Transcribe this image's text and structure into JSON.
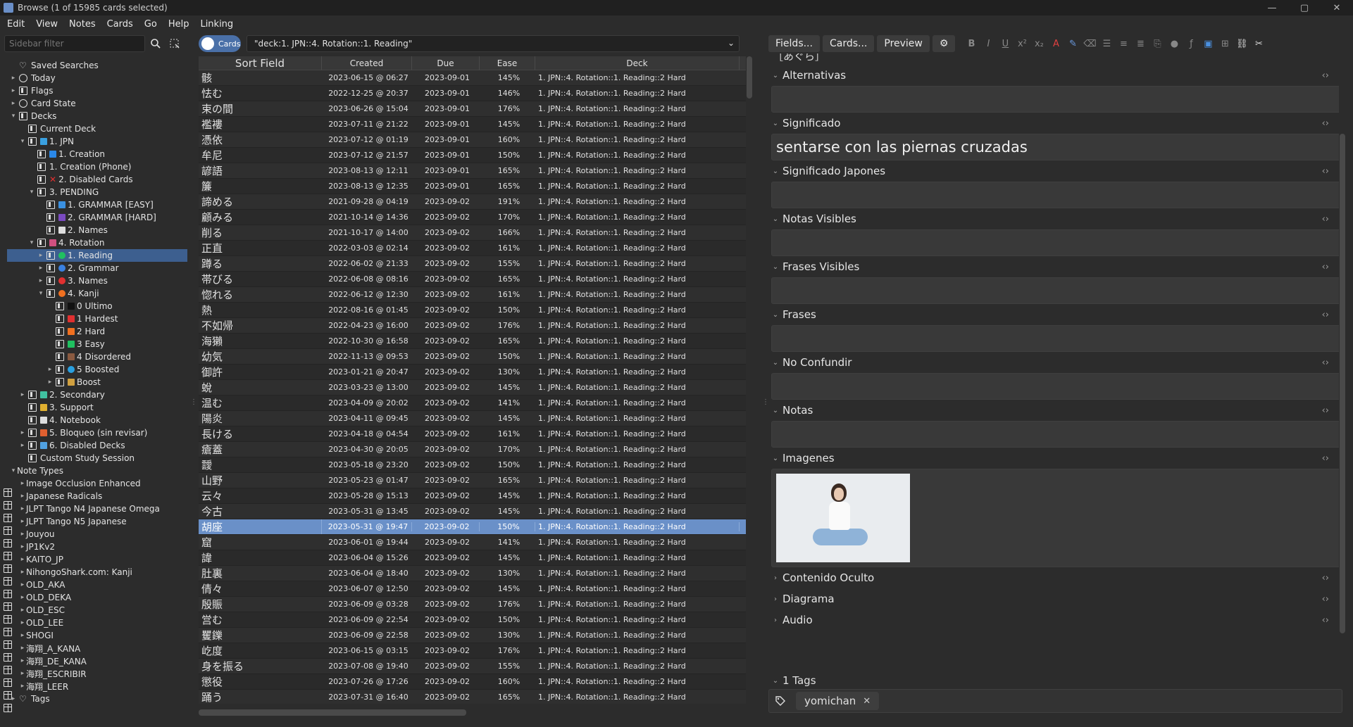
{
  "window": {
    "title": "Browse (1 of 15985 cards selected)",
    "minimize": "—",
    "maximize": "▢",
    "close": "✕"
  },
  "menu": [
    "Edit",
    "View",
    "Notes",
    "Cards",
    "Go",
    "Help",
    "Linking"
  ],
  "sidebar": {
    "filter_placeholder": "Sidebar filter",
    "tree": [
      {
        "d": 0,
        "a": "",
        "ic": "heart",
        "t": "Saved Searches"
      },
      {
        "d": 0,
        "a": "▸",
        "ic": "circle",
        "t": "Today"
      },
      {
        "d": 0,
        "a": "▸",
        "ic": "deck",
        "t": "Flags"
      },
      {
        "d": 0,
        "a": "▸",
        "ic": "circle",
        "t": "Card State"
      },
      {
        "d": 0,
        "a": "▾",
        "ic": "deck",
        "t": "Decks"
      },
      {
        "d": 1,
        "a": "",
        "ic": "deck",
        "t": "Current Deck"
      },
      {
        "d": 1,
        "a": "▾",
        "ic": "deck",
        "t": "1. JPN",
        "sw": "#3aa0e0"
      },
      {
        "d": 2,
        "a": "",
        "ic": "deck",
        "t": "1. Creation",
        "sw": "#2a88e8"
      },
      {
        "d": 2,
        "a": "",
        "ic": "deck",
        "t": "1. Creation (Phone)"
      },
      {
        "d": 2,
        "a": "",
        "ic": "deck",
        "t": "2. Disabled Cards",
        "x": "#e03030"
      },
      {
        "d": 2,
        "a": "▾",
        "ic": "deck",
        "t": "3. PENDING"
      },
      {
        "d": 3,
        "a": "",
        "ic": "deck",
        "t": "1. GRAMMAR [EASY]",
        "sw": "#3a90e0"
      },
      {
        "d": 3,
        "a": "",
        "ic": "deck",
        "t": "2. GRAMMAR [HARD]",
        "sw": "#7a4ac0"
      },
      {
        "d": 3,
        "a": "",
        "ic": "deck",
        "t": "2. Names",
        "sw": "#dddddd"
      },
      {
        "d": 2,
        "a": "▾",
        "ic": "deck",
        "t": "4. Rotation",
        "sw": "#d05080"
      },
      {
        "d": 3,
        "a": "▸",
        "ic": "deck",
        "t": "1. Reading",
        "dot": "#20c060",
        "sel": true
      },
      {
        "d": 3,
        "a": "▸",
        "ic": "deck",
        "t": "2. Grammar",
        "dot": "#3a80e0"
      },
      {
        "d": 3,
        "a": "▸",
        "ic": "deck",
        "t": "3. Names",
        "dot": "#e03030"
      },
      {
        "d": 3,
        "a": "▾",
        "ic": "deck",
        "t": "4. Kanji",
        "dot": "#f07020"
      },
      {
        "d": 4,
        "a": "",
        "ic": "deck",
        "t": "0 Ultimo",
        "sw": "#111111"
      },
      {
        "d": 4,
        "a": "",
        "ic": "deck",
        "t": "1 Hardest",
        "sw": "#e03030"
      },
      {
        "d": 4,
        "a": "",
        "ic": "deck",
        "t": "2 Hard",
        "sw": "#f07020"
      },
      {
        "d": 4,
        "a": "",
        "ic": "deck",
        "t": "3 Easy",
        "sw": "#20c060"
      },
      {
        "d": 4,
        "a": "",
        "ic": "deck",
        "t": "4 Disordered",
        "sw": "#8a5a40"
      },
      {
        "d": 4,
        "a": "▸",
        "ic": "deck",
        "t": "5 Boosted",
        "dot": "#2aa0e0"
      },
      {
        "d": 4,
        "a": "▸",
        "ic": "deck",
        "t": "Boost",
        "sw": "#d0a040"
      },
      {
        "d": 1,
        "a": "▸",
        "ic": "deck",
        "t": "2. Secondary",
        "sw": "#40c0a0"
      },
      {
        "d": 1,
        "a": "",
        "ic": "deck",
        "t": "3. Support",
        "sw": "#e0b030"
      },
      {
        "d": 1,
        "a": "",
        "ic": "deck",
        "t": "4. Notebook",
        "sw": "#dddddd"
      },
      {
        "d": 1,
        "a": "▸",
        "ic": "deck",
        "t": "5. Bloqueo (sin revisar)",
        "sw": "#e06030"
      },
      {
        "d": 1,
        "a": "▸",
        "ic": "deck",
        "t": "6. Disabled Decks",
        "sw": "#50a0e0"
      },
      {
        "d": 1,
        "a": "",
        "ic": "deck",
        "t": "Custom Study Session"
      },
      {
        "d": 0,
        "a": "▾",
        "ic": "table",
        "t": "Note Types"
      },
      {
        "d": 1,
        "a": "▸",
        "ic": "table",
        "t": "Image Occlusion Enhanced"
      },
      {
        "d": 1,
        "a": "▸",
        "ic": "table",
        "t": "Japanese Radicals"
      },
      {
        "d": 1,
        "a": "▸",
        "ic": "table",
        "t": "JLPT Tango N4 Japanese Omega"
      },
      {
        "d": 1,
        "a": "▸",
        "ic": "table",
        "t": "JLPT Tango N5 Japanese"
      },
      {
        "d": 1,
        "a": "▸",
        "ic": "table",
        "t": "Jouyou"
      },
      {
        "d": 1,
        "a": "▸",
        "ic": "table",
        "t": "JP1Kv2"
      },
      {
        "d": 1,
        "a": "▸",
        "ic": "table",
        "t": "KAITO_JP"
      },
      {
        "d": 1,
        "a": "▸",
        "ic": "table",
        "t": "NihongoShark.com: Kanji"
      },
      {
        "d": 1,
        "a": "▸",
        "ic": "table",
        "t": "OLD_AKA"
      },
      {
        "d": 1,
        "a": "▸",
        "ic": "table",
        "t": "OLD_DEKA"
      },
      {
        "d": 1,
        "a": "▸",
        "ic": "table",
        "t": "OLD_ESC"
      },
      {
        "d": 1,
        "a": "▸",
        "ic": "table",
        "t": "OLD_LEE"
      },
      {
        "d": 1,
        "a": "▸",
        "ic": "table",
        "t": "SHOGI"
      },
      {
        "d": 1,
        "a": "▸",
        "ic": "table",
        "t": "海翔_A_KANA"
      },
      {
        "d": 1,
        "a": "▸",
        "ic": "table",
        "t": "海翔_DE_KANA"
      },
      {
        "d": 1,
        "a": "▸",
        "ic": "table",
        "t": "海翔_ESCRIBIR"
      },
      {
        "d": 1,
        "a": "▸",
        "ic": "table",
        "t": "海翔_LEER"
      },
      {
        "d": 0,
        "a": "▸",
        "ic": "heart",
        "t": "Tags"
      }
    ]
  },
  "browser": {
    "toggle_label": "Cards",
    "search_query": "\"deck:1. JPN::4. Rotation::1. Reading\"",
    "columns": [
      "Sort Field",
      "Created",
      "Due",
      "Ease",
      "Deck"
    ],
    "deck_text": "1. JPN::4. Rotation::1. Reading::2 Hard",
    "rows": [
      [
        "骸",
        "2023-06-15 @ 06:27",
        "2023-09-01",
        "145%"
      ],
      [
        "怯む",
        "2022-12-25 @ 20:37",
        "2023-09-01",
        "146%"
      ],
      [
        "束の間",
        "2023-06-26 @ 15:04",
        "2023-09-01",
        "176%"
      ],
      [
        "襤褸",
        "2023-07-11 @ 21:22",
        "2023-09-01",
        "145%"
      ],
      [
        "憑依",
        "2023-07-12 @ 01:19",
        "2023-09-01",
        "160%"
      ],
      [
        "牟尼",
        "2023-07-12 @ 21:57",
        "2023-09-01",
        "150%"
      ],
      [
        "諺語",
        "2023-08-13 @ 12:11",
        "2023-09-01",
        "165%"
      ],
      [
        "簾",
        "2023-08-13 @ 12:35",
        "2023-09-01",
        "165%"
      ],
      [
        "諦める",
        "2021-09-28 @ 04:19",
        "2023-09-02",
        "191%"
      ],
      [
        "顧みる",
        "2021-10-14 @ 14:36",
        "2023-09-02",
        "170%"
      ],
      [
        "削る",
        "2021-10-17 @ 14:00",
        "2023-09-02",
        "166%"
      ],
      [
        "正直",
        "2022-03-03 @ 02:14",
        "2023-09-02",
        "161%"
      ],
      [
        "蹲る",
        "2022-06-02 @ 21:33",
        "2023-09-02",
        "155%"
      ],
      [
        "帯びる",
        "2022-06-08 @ 08:16",
        "2023-09-02",
        "165%"
      ],
      [
        "惚れる",
        "2022-06-12 @ 12:30",
        "2023-09-02",
        "161%"
      ],
      [
        "熱",
        "2022-08-16 @ 01:45",
        "2023-09-02",
        "150%"
      ],
      [
        "不如帰",
        "2022-04-23 @ 16:00",
        "2023-09-02",
        "176%"
      ],
      [
        "海獺",
        "2022-10-30 @ 16:58",
        "2023-09-02",
        "165%"
      ],
      [
        "幼気",
        "2022-11-13 @ 09:53",
        "2023-09-02",
        "150%"
      ],
      [
        "御許",
        "2023-01-21 @ 20:47",
        "2023-09-02",
        "130%"
      ],
      [
        "蛻",
        "2023-03-23 @ 13:00",
        "2023-09-02",
        "145%"
      ],
      [
        "温む",
        "2023-04-09 @ 20:02",
        "2023-09-02",
        "141%"
      ],
      [
        "陽炎",
        "2023-04-11 @ 09:45",
        "2023-09-02",
        "145%"
      ],
      [
        "長ける",
        "2023-04-18 @ 04:54",
        "2023-09-02",
        "161%"
      ],
      [
        "瘡蓋",
        "2023-04-30 @ 20:05",
        "2023-09-02",
        "170%"
      ],
      [
        "靉",
        "2023-05-18 @ 23:20",
        "2023-09-02",
        "150%"
      ],
      [
        "山野",
        "2023-05-23 @ 01:47",
        "2023-09-02",
        "165%"
      ],
      [
        "云々",
        "2023-05-28 @ 15:13",
        "2023-09-02",
        "145%"
      ],
      [
        "今古",
        "2023-05-31 @ 13:45",
        "2023-09-02",
        "145%"
      ],
      [
        "胡座",
        "2023-05-31 @ 19:47",
        "2023-09-02",
        "150%"
      ],
      [
        "窟",
        "2023-06-01 @ 19:44",
        "2023-09-02",
        "141%"
      ],
      [
        "諱",
        "2023-06-04 @ 15:26",
        "2023-09-02",
        "145%"
      ],
      [
        "肚裏",
        "2023-06-04 @ 18:40",
        "2023-09-02",
        "130%"
      ],
      [
        "倩々",
        "2023-06-07 @ 12:50",
        "2023-09-02",
        "145%"
      ],
      [
        "殷賑",
        "2023-06-09 @ 03:28",
        "2023-09-02",
        "176%"
      ],
      [
        "営む",
        "2023-06-09 @ 22:54",
        "2023-09-02",
        "150%"
      ],
      [
        "矍鑠",
        "2023-06-09 @ 22:58",
        "2023-09-02",
        "130%"
      ],
      [
        "屹度",
        "2023-06-15 @ 03:15",
        "2023-09-02",
        "176%"
      ],
      [
        "身を振る",
        "2023-07-08 @ 19:40",
        "2023-09-02",
        "155%"
      ],
      [
        "懲役",
        "2023-07-26 @ 17:26",
        "2023-09-02",
        "160%"
      ],
      [
        "踊う",
        "2023-07-31 @ 16:40",
        "2023-09-02",
        "165%"
      ]
    ],
    "selected_index": 29
  },
  "editor": {
    "buttons": {
      "fields": "Fields...",
      "cards": "Cards...",
      "preview": "Preview"
    },
    "partial_top": "［あぐら］",
    "fields": [
      {
        "name": "Alternativas",
        "value": "",
        "open": true
      },
      {
        "name": "Significado",
        "value": "sentarse con las piernas cruzadas",
        "open": true
      },
      {
        "name": "Significado Japones",
        "value": "",
        "open": true
      },
      {
        "name": "Notas Visibles",
        "value": "",
        "open": true
      },
      {
        "name": "Frases Visibles",
        "value": "",
        "open": true
      },
      {
        "name": "Frases",
        "value": "",
        "open": true
      },
      {
        "name": "No Confundir",
        "value": "",
        "open": true
      },
      {
        "name": "Notas",
        "value": "",
        "open": true
      },
      {
        "name": "Imagenes",
        "value": "",
        "open": true,
        "image": true
      },
      {
        "name": "Contenido Oculto",
        "value": "",
        "open": false
      },
      {
        "name": "Diagrama",
        "value": "",
        "open": false
      },
      {
        "name": "Audio",
        "value": "",
        "open": false
      }
    ],
    "tags_label": "1 Tags",
    "tags": [
      "yomichan"
    ]
  },
  "colors": {
    "selection": "#3d5f8f",
    "row_selected": "#6a90c8",
    "hard": "#f07020",
    "reading": "#20c060",
    "rotation": "#d05080"
  }
}
